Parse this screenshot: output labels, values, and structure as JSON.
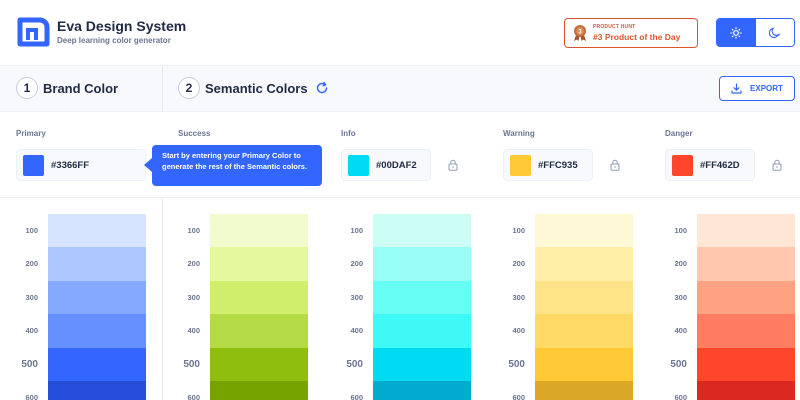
{
  "header": {
    "title": "Eva Design System",
    "subtitle": "Deep learning color generator",
    "product_hunt": {
      "small": "PRODUCT HUNT",
      "big": "#3 Product of the Day",
      "icon": "medal-icon"
    },
    "theme": {
      "light_icon": "sun-icon",
      "dark_icon": "moon-icon",
      "active": "light"
    }
  },
  "steps": [
    {
      "number": "1",
      "title": "Brand Color"
    },
    {
      "number": "2",
      "title": "Semantic Colors"
    }
  ],
  "export_label": "EXPORT",
  "tooltip": "Start by entering your Primary Color to generate the rest of the Semantic colors.",
  "columns": [
    {
      "label": "Primary",
      "hex": "#3366FF",
      "color": "#3366ff",
      "shades": [
        "#d6e4ff",
        "#adc8ff",
        "#84a9ff",
        "#6690ff",
        "#3366ff",
        "#254edb"
      ]
    },
    {
      "label": "Success",
      "hex": "",
      "color": "#8fbe00",
      "shades": [
        "#f1fbce",
        "#e4f89e",
        "#d0ed6c",
        "#b4db45",
        "#8fbe0f",
        "#77a300"
      ]
    },
    {
      "label": "Info",
      "hex": "#00DAF2",
      "color": "#00daf2",
      "shades": [
        "#ccfef5",
        "#99fef3",
        "#66fef5",
        "#3ff9f7",
        "#00daf2",
        "#00abd0"
      ]
    },
    {
      "label": "Warning",
      "hex": "#FFC935",
      "color": "#ffc935",
      "shades": [
        "#fff8d6",
        "#ffeea6",
        "#ffe386",
        "#ffd966",
        "#ffc935",
        "#dba726"
      ]
    },
    {
      "label": "Danger",
      "hex": "#FF462D",
      "color": "#ff462d",
      "shades": [
        "#ffe6d5",
        "#ffc7ac",
        "#ffa282",
        "#ff7e63",
        "#ff462d",
        "#db2821"
      ]
    }
  ],
  "shade_levels": [
    "100",
    "200",
    "300",
    "400",
    "500",
    "600"
  ]
}
